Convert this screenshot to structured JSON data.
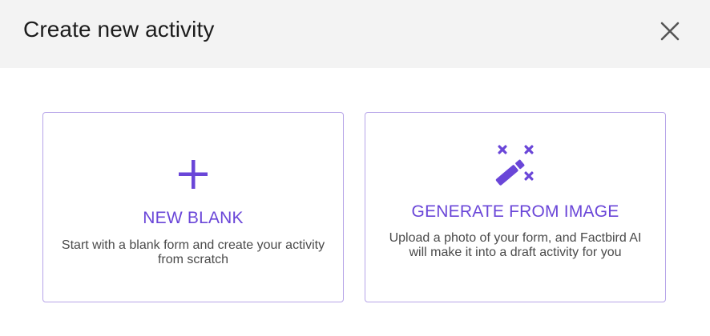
{
  "dialog": {
    "title": "Create new activity",
    "close_icon": "close-icon"
  },
  "options": [
    {
      "title": "NEW BLANK",
      "description": "Start with a blank form and create your activity from scratch",
      "icon": "plus-icon"
    },
    {
      "title": "GENERATE FROM IMAGE",
      "description": "Upload a photo of your form, and Factbird AI will make it into a draft activity for you",
      "icon": "magic-wand-icon"
    }
  ],
  "colors": {
    "accent": "#6a46d8",
    "card_border": "#b6a4e8",
    "header_bg": "#f3f3f3"
  }
}
